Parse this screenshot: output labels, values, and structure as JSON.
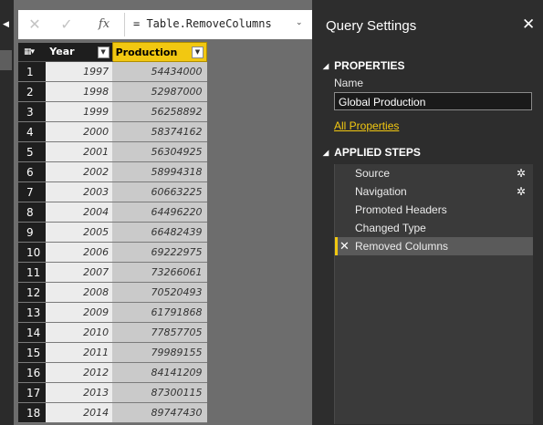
{
  "formula_bar": {
    "cancel_icon": "✕",
    "commit_icon": "✓",
    "fx_label": "fx",
    "formula": "= Table.RemoveColumns",
    "expand_icon": "❤"
  },
  "grid": {
    "columns": [
      "Year",
      "Production"
    ],
    "rows": [
      {
        "idx": "1",
        "year": "1997",
        "production": "54434000"
      },
      {
        "idx": "2",
        "year": "1998",
        "production": "52987000"
      },
      {
        "idx": "3",
        "year": "1999",
        "production": "56258892"
      },
      {
        "idx": "4",
        "year": "2000",
        "production": "58374162"
      },
      {
        "idx": "5",
        "year": "2001",
        "production": "56304925"
      },
      {
        "idx": "6",
        "year": "2002",
        "production": "58994318"
      },
      {
        "idx": "7",
        "year": "2003",
        "production": "60663225"
      },
      {
        "idx": "8",
        "year": "2004",
        "production": "64496220"
      },
      {
        "idx": "9",
        "year": "2005",
        "production": "66482439"
      },
      {
        "idx": "10",
        "year": "2006",
        "production": "69222975"
      },
      {
        "idx": "11",
        "year": "2007",
        "production": "73266061"
      },
      {
        "idx": "12",
        "year": "2008",
        "production": "70520493"
      },
      {
        "idx": "13",
        "year": "2009",
        "production": "61791868"
      },
      {
        "idx": "14",
        "year": "2010",
        "production": "77857705"
      },
      {
        "idx": "15",
        "year": "2011",
        "production": "79989155"
      },
      {
        "idx": "16",
        "year": "2012",
        "production": "84141209"
      },
      {
        "idx": "17",
        "year": "2013",
        "production": "87300115"
      },
      {
        "idx": "18",
        "year": "2014",
        "production": "89747430"
      }
    ]
  },
  "settings": {
    "title": "Query Settings",
    "close_icon": "✕",
    "properties_heading": "PROPERTIES",
    "name_label": "Name",
    "name_value": "Global Production",
    "all_properties_link": "All Properties",
    "applied_steps_heading": "APPLIED STEPS",
    "steps": [
      {
        "label": "Source",
        "has_gear": true
      },
      {
        "label": "Navigation",
        "has_gear": true
      },
      {
        "label": "Promoted Headers",
        "has_gear": false
      },
      {
        "label": "Changed Type",
        "has_gear": false
      },
      {
        "label": "Removed Columns",
        "has_gear": false,
        "active": true
      }
    ]
  },
  "colors": {
    "accent": "#f2c811",
    "panel_bg": "#2d2d2d",
    "main_bg": "#6d6d6d"
  }
}
